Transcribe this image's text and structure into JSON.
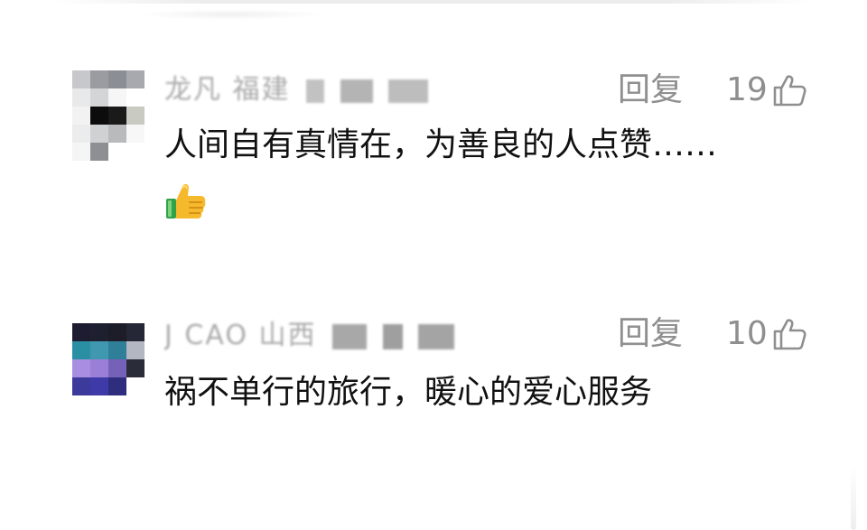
{
  "comments": [
    {
      "username": "龙凡 福建",
      "reply_label": "回复",
      "like_count": "19",
      "text": "人间自有真情在，为善良的人点赞……",
      "emoji": "thumbs-up-emoji"
    },
    {
      "username": "J CAO 山西",
      "reply_label": "回复",
      "like_count": "10",
      "text": "祸不单行的旅行，暖心的爱心服务"
    }
  ],
  "icons": {
    "like": "thumbs-up-outline-icon"
  },
  "colors": {
    "meta_gray": "#8f8f8f",
    "text": "#111111",
    "username_gray": "#a9a9a9"
  }
}
